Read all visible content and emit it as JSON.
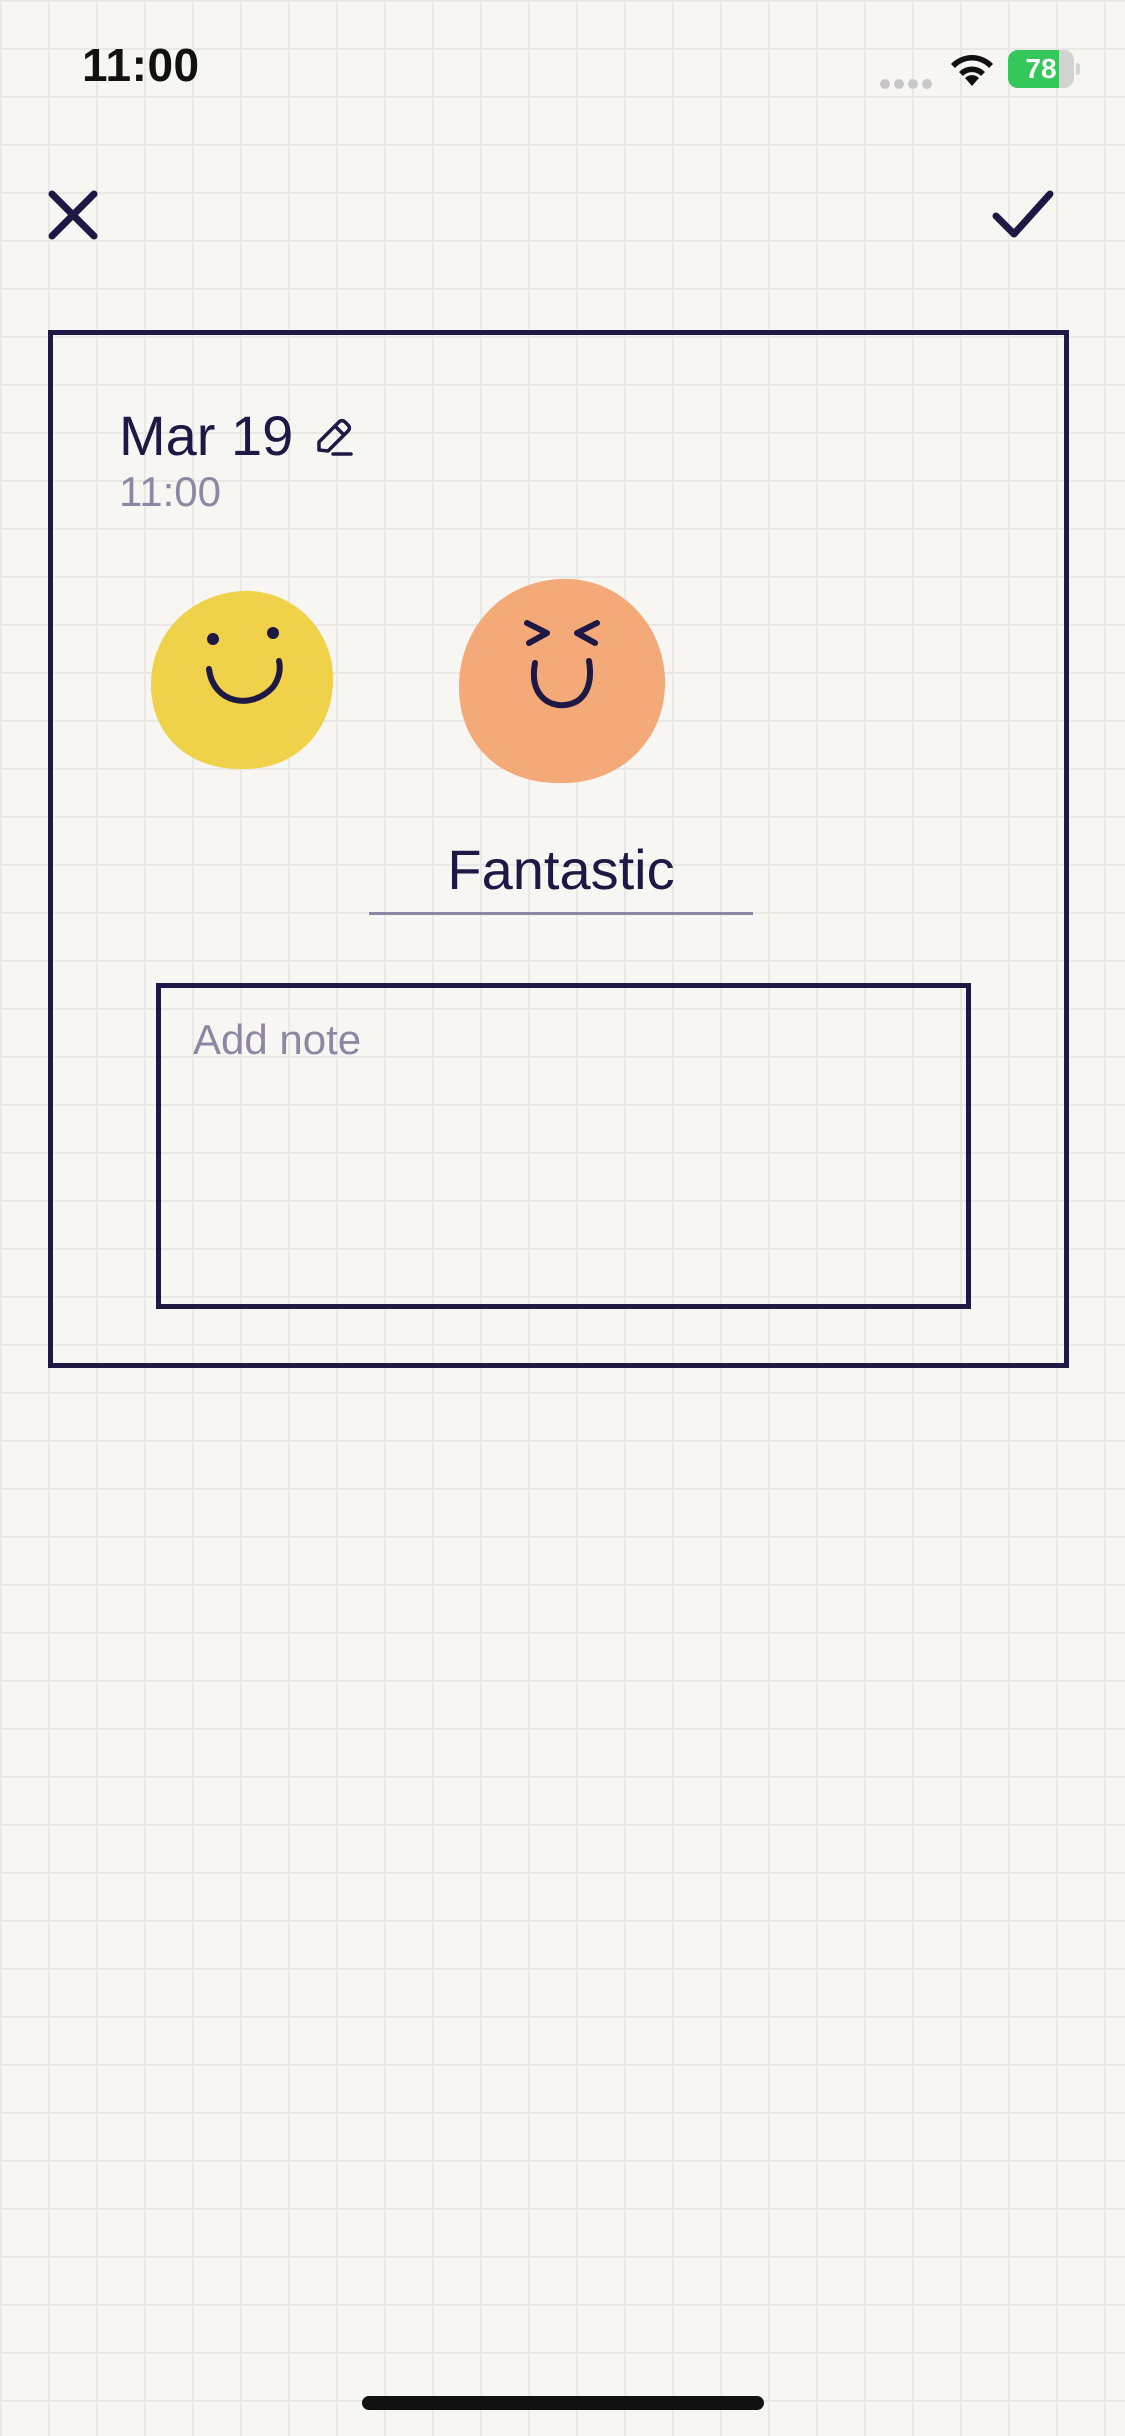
{
  "status_bar": {
    "time": "11:00",
    "battery": "78",
    "battery_level_percent": 78
  },
  "toolbar": {
    "close_icon": "close-icon",
    "confirm_icon": "checkmark-icon"
  },
  "entry": {
    "date": "Mar 19",
    "date_edit_icon": "pencil-icon",
    "time": "11:00",
    "moods": [
      {
        "icon": "good-mood-face-icon",
        "color": "#f0d24a"
      },
      {
        "icon": "fantastic-mood-face-icon",
        "color": "#f4a978"
      }
    ],
    "selected_mood": "Fantastic",
    "note_placeholder": "Add note"
  },
  "colors": {
    "ink": "#1e1845",
    "muted": "#8c88a3",
    "background": "#f7f6f3",
    "battery_green": "#34c759"
  }
}
